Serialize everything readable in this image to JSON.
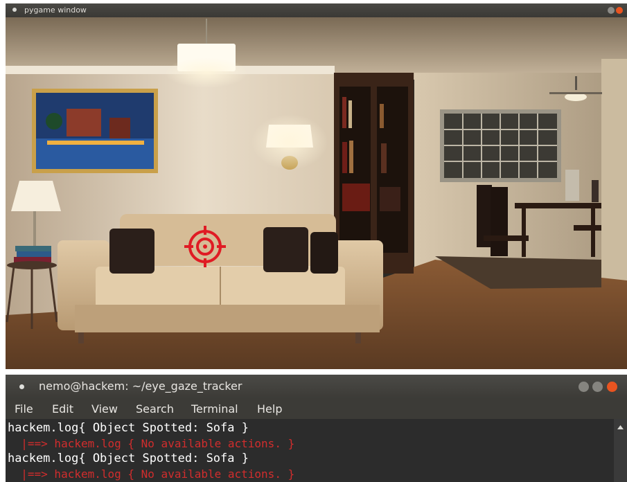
{
  "pygame_window": {
    "title": "pygame window"
  },
  "terminal": {
    "title": "nemo@hackem: ~/eye_gaze_tracker",
    "menu": [
      "File",
      "Edit",
      "View",
      "Search",
      "Terminal",
      "Help"
    ],
    "lines": [
      "hackem.log{ Object Spotted: Sofa }",
      "  |==> hackem.log { No available actions. }",
      "hackem.log{ Object Spotted: Sofa }",
      "  |==> hackem.log { No available actions. }"
    ]
  },
  "colors": {
    "crosshair": "#e01b24",
    "error_text": "#d22d2d",
    "close_button": "#e95420"
  }
}
